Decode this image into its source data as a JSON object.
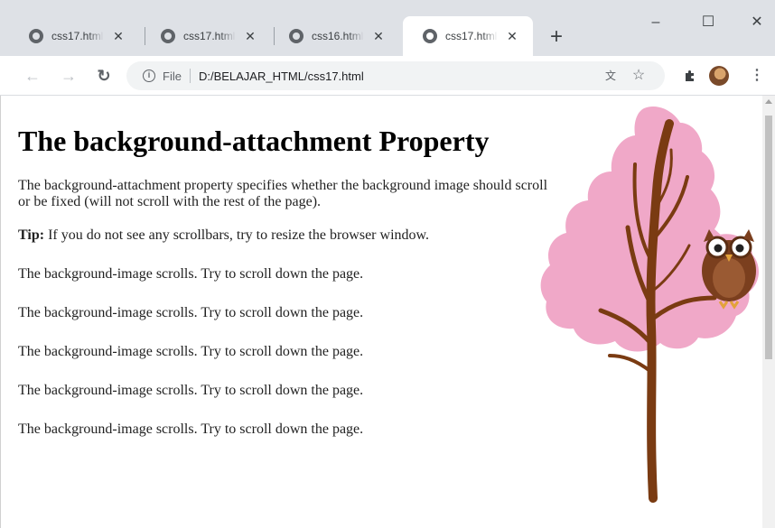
{
  "browser": {
    "tabs": [
      {
        "title": "css17.html",
        "active": false
      },
      {
        "title": "css17.html",
        "active": false
      },
      {
        "title": "css16.html",
        "active": false
      },
      {
        "title": "css17.html",
        "active": true
      }
    ],
    "new_tab_label": "+",
    "window_controls": {
      "minimize": "–",
      "maximize": "☐",
      "close": "✕"
    },
    "nav": {
      "back": "←",
      "forward": "→",
      "reload": "↻"
    },
    "address": {
      "scheme_label": "File",
      "url": "D:/BELAJAR_HTML/css17.html"
    },
    "icons": {
      "info": "info-icon",
      "translate": "translate-icon",
      "bookmark": "star-icon",
      "extensions": "puzzle-icon",
      "profile": "avatar",
      "menu": "kebab-menu-icon"
    }
  },
  "page": {
    "heading": "The background-attachment Property",
    "description": "The background-attachment property specifies whether the background image should scroll or be fixed (will not scroll with the rest of the page).",
    "tip_label": "Tip:",
    "tip_text": " If you do not see any scrollbars, try to resize the browser window.",
    "scroll_lines": [
      "The background-image scrolls. Try to scroll down the page.",
      "The background-image scrolls. Try to scroll down the page.",
      "The background-image scrolls. Try to scroll down the page.",
      "The background-image scrolls. Try to scroll down the page.",
      "The background-image scrolls. Try to scroll down the page."
    ],
    "background_image": "tree-with-owl-illustration"
  },
  "colors": {
    "tab_strip": "#dee1e6",
    "tree_foliage": "#f0a8c8",
    "tree_trunk": "#7a3b12",
    "owl_body": "#7b3f1e"
  }
}
